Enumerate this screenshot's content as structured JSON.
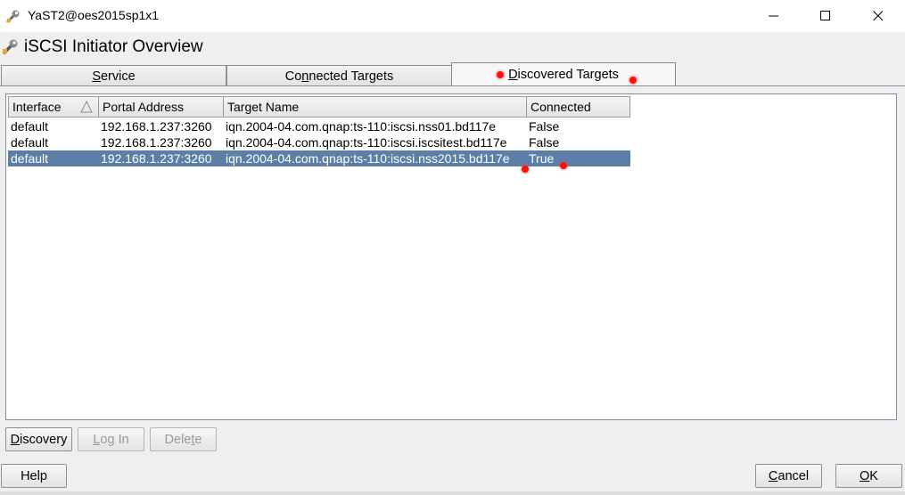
{
  "window": {
    "title": "YaST2@oes2015sp1x1"
  },
  "header": {
    "title": "iSCSI Initiator Overview"
  },
  "tabs": [
    {
      "label_pre": "",
      "label_u": "S",
      "label_post": "ervice",
      "active": false
    },
    {
      "label_pre": "Co",
      "label_u": "n",
      "label_post": "nected Targets",
      "active": false
    },
    {
      "label_pre": "",
      "label_u": "D",
      "label_post": "iscovered Targets",
      "active": true
    }
  ],
  "table": {
    "columns": [
      "Interface",
      "Portal Address",
      "Target Name",
      "Connected"
    ],
    "rows": [
      {
        "interface": "default",
        "portal": "192.168.1.237:3260",
        "target": "iqn.2004-04.com.qnap:ts-110:iscsi.nss01.bd117e",
        "connected": "False",
        "selected": false
      },
      {
        "interface": "default",
        "portal": "192.168.1.237:3260",
        "target": "iqn.2004-04.com.qnap:ts-110:iscsi.iscsitest.bd117e",
        "connected": "False",
        "selected": false
      },
      {
        "interface": "default",
        "portal": "192.168.1.237:3260",
        "target": "iqn.2004-04.com.qnap:ts-110:iscsi.nss2015.bd117e",
        "connected": "True",
        "selected": true
      }
    ]
  },
  "actions": {
    "discovery": {
      "pre": "",
      "u": "D",
      "post": "iscovery"
    },
    "login": {
      "pre": "",
      "u": "L",
      "post": "og In"
    },
    "delete": {
      "pre": "Dele",
      "u": "t",
      "post": "e"
    }
  },
  "footer": {
    "help": "Help",
    "cancel": {
      "pre": "",
      "u": "C",
      "post": "ancel"
    },
    "ok": {
      "pre": "",
      "u": "O",
      "post": "K"
    }
  },
  "colors": {
    "selection": "#5b7fa6",
    "marker": "#ff1010"
  },
  "icons": [
    "yast-wrench-icon",
    "minimize-icon",
    "maximize-icon",
    "close-icon",
    "sort-ascending-icon"
  ]
}
